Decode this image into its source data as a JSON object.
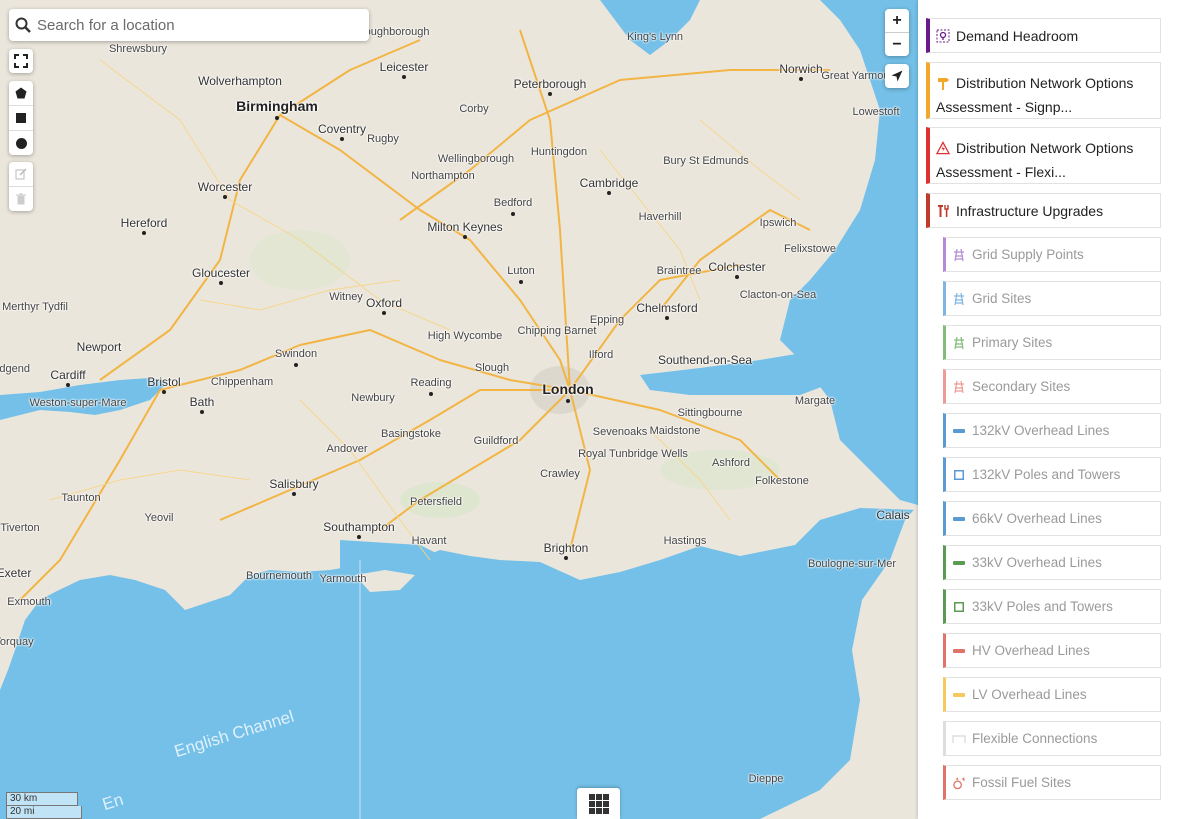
{
  "search": {
    "placeholder": "Search for a location"
  },
  "map": {
    "sea_label": "English Channel",
    "sea_label_partial": "En",
    "places": [
      {
        "name": "Birmingham",
        "size": "big"
      },
      {
        "name": "London",
        "size": "big"
      },
      {
        "name": "Wolverhampton",
        "size": "mid"
      },
      {
        "name": "Shrewsbury",
        "size": "small"
      },
      {
        "name": "Leicester",
        "size": "mid"
      },
      {
        "name": "Loughborough",
        "size": "small"
      },
      {
        "name": "Peterborough",
        "size": "mid"
      },
      {
        "name": "King's Lynn",
        "size": "small"
      },
      {
        "name": "Norwich",
        "size": "mid"
      },
      {
        "name": "Great Yarmouth",
        "size": "small"
      },
      {
        "name": "Lowestoft",
        "size": "small"
      },
      {
        "name": "Coventry",
        "size": "mid"
      },
      {
        "name": "Rugby",
        "size": "small"
      },
      {
        "name": "Corby",
        "size": "small"
      },
      {
        "name": "Huntingdon",
        "size": "small"
      },
      {
        "name": "Wellingborough",
        "size": "small"
      },
      {
        "name": "Northampton",
        "size": "small"
      },
      {
        "name": "Bury St Edmunds",
        "size": "small"
      },
      {
        "name": "Cambridge",
        "size": "mid"
      },
      {
        "name": "Worcester",
        "size": "mid"
      },
      {
        "name": "Bedford",
        "size": "small"
      },
      {
        "name": "Haverhill",
        "size": "small"
      },
      {
        "name": "Ipswich",
        "size": "small"
      },
      {
        "name": "Hereford",
        "size": "mid"
      },
      {
        "name": "Milton Keynes",
        "size": "mid"
      },
      {
        "name": "Felixstowe",
        "size": "small"
      },
      {
        "name": "Luton",
        "size": "small"
      },
      {
        "name": "Braintree",
        "size": "small"
      },
      {
        "name": "Colchester",
        "size": "mid"
      },
      {
        "name": "Gloucester",
        "size": "mid"
      },
      {
        "name": "Clacton-on-Sea",
        "size": "small"
      },
      {
        "name": "Witney",
        "size": "small"
      },
      {
        "name": "Oxford",
        "size": "mid"
      },
      {
        "name": "Chipping Barnet",
        "size": "small"
      },
      {
        "name": "Epping",
        "size": "small"
      },
      {
        "name": "Chelmsford",
        "size": "mid"
      },
      {
        "name": "Merthyr Tydfil",
        "size": "small"
      },
      {
        "name": "High Wycombe",
        "size": "small"
      },
      {
        "name": "Newport",
        "size": "mid"
      },
      {
        "name": "Swindon",
        "size": "small"
      },
      {
        "name": "Ilford",
        "size": "small"
      },
      {
        "name": "Southend-on-Sea",
        "size": "mid"
      },
      {
        "name": "Cardiff",
        "size": "mid"
      },
      {
        "name": "Slough",
        "size": "small"
      },
      {
        "name": "Bristol",
        "size": "mid"
      },
      {
        "name": "Chippenham",
        "size": "small"
      },
      {
        "name": "Reading",
        "size": "small"
      },
      {
        "name": "Bath",
        "size": "mid"
      },
      {
        "name": "Newbury",
        "size": "small"
      },
      {
        "name": "Weston-super-Mare",
        "size": "small"
      },
      {
        "name": "Sittingbourne",
        "size": "small"
      },
      {
        "name": "Margate",
        "size": "small"
      },
      {
        "name": "Sevenoaks",
        "size": "small"
      },
      {
        "name": "Maidstone",
        "size": "small"
      },
      {
        "name": "Basingstoke",
        "size": "small"
      },
      {
        "name": "Guildford",
        "size": "small"
      },
      {
        "name": "Andover",
        "size": "small"
      },
      {
        "name": "Royal Tunbridge Wells",
        "size": "small"
      },
      {
        "name": "Crawley",
        "size": "small"
      },
      {
        "name": "Ashford",
        "size": "small"
      },
      {
        "name": "Salisbury",
        "size": "mid"
      },
      {
        "name": "Folkestone",
        "size": "small"
      },
      {
        "name": "Taunton",
        "size": "small"
      },
      {
        "name": "Yeovil",
        "size": "small"
      },
      {
        "name": "Petersfield",
        "size": "small"
      },
      {
        "name": "Calais",
        "size": "mid"
      },
      {
        "name": "Tiverton",
        "size": "small"
      },
      {
        "name": "Southampton",
        "size": "mid"
      },
      {
        "name": "Havant",
        "size": "small"
      },
      {
        "name": "Hastings",
        "size": "small"
      },
      {
        "name": "Brighton",
        "size": "mid"
      },
      {
        "name": "Boulogne-sur-Mer",
        "size": "small"
      },
      {
        "name": "Exeter",
        "size": "mid"
      },
      {
        "name": "Bournemouth",
        "size": "small"
      },
      {
        "name": "Yarmouth",
        "size": "small"
      },
      {
        "name": "Exmouth",
        "size": "small"
      },
      {
        "name": "Torquay",
        "size": "small"
      },
      {
        "name": "Dieppe",
        "size": "small"
      },
      {
        "name": "Bridgend",
        "size": "small"
      }
    ]
  },
  "scale": {
    "km": "30 km",
    "mi": "20 mi"
  },
  "zoom": {
    "in": "+",
    "out": "−"
  },
  "layers": [
    {
      "label": "Demand Headroom",
      "color": "#6a1b8a",
      "icon": "map-pin-icon",
      "level": "top"
    },
    {
      "label": "Distribution Network Options Assessment - Signp...",
      "color": "#f2a92b",
      "icon": "signpost-icon",
      "level": "top"
    },
    {
      "label": "Distribution Network Options Assessment - Flexi...",
      "color": "#e03131",
      "icon": "warning-bolt-icon",
      "level": "top"
    },
    {
      "label": "Infrastructure Upgrades",
      "color": "#c0392b",
      "icon": "tools-icon",
      "level": "top"
    },
    {
      "label": "Grid Supply Points",
      "color": "#b48ad6",
      "icon": "pylon-icon",
      "level": "sub"
    },
    {
      "label": "Grid Sites",
      "color": "#7fb5e0",
      "icon": "pylon-icon",
      "level": "sub"
    },
    {
      "label": "Primary Sites",
      "color": "#82bb7a",
      "icon": "pylon-icon",
      "level": "sub"
    },
    {
      "label": "Secondary Sites",
      "color": "#ec9b95",
      "icon": "pylon-icon",
      "level": "sub"
    },
    {
      "label": "132kV Overhead Lines",
      "color": "#5b9bd5",
      "icon": "line-icon",
      "level": "sub"
    },
    {
      "label": "132kV Poles and Towers",
      "color": "#5b9bd5",
      "icon": "square-icon",
      "level": "sub"
    },
    {
      "label": "66kV Overhead Lines",
      "color": "#5b9bd5",
      "icon": "line-icon",
      "level": "sub"
    },
    {
      "label": "33kV Overhead Lines",
      "color": "#5a9a52",
      "icon": "line-icon",
      "level": "sub"
    },
    {
      "label": "33kV Poles and Towers",
      "color": "#5a9a52",
      "icon": "square-icon",
      "level": "sub"
    },
    {
      "label": "HV Overhead Lines",
      "color": "#e07468",
      "icon": "line-icon",
      "level": "sub"
    },
    {
      "label": "LV Overhead Lines",
      "color": "#f5c95e",
      "icon": "line-icon",
      "level": "sub"
    },
    {
      "label": "Flexible Connections",
      "color": "#dddddd",
      "icon": "connection-icon",
      "level": "sub"
    },
    {
      "label": "Fossil Fuel Sites",
      "color": "#e07468",
      "icon": "factory-icon",
      "level": "sub"
    }
  ]
}
